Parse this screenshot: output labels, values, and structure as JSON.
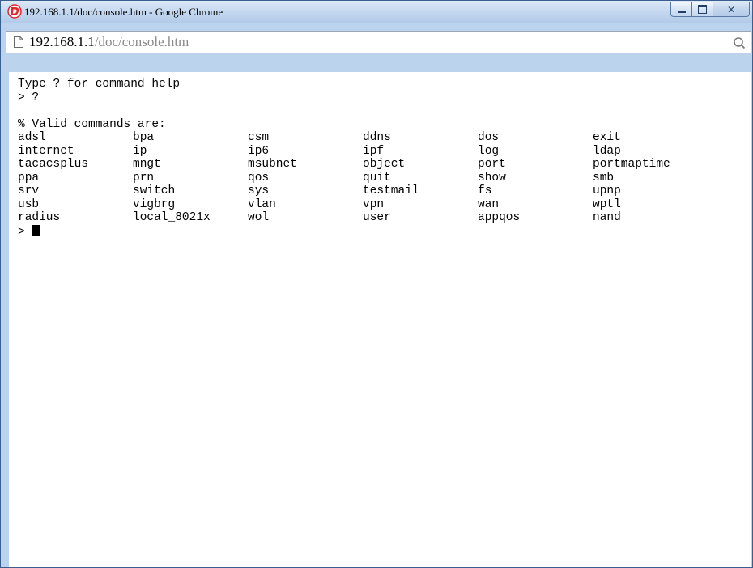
{
  "window": {
    "title": "192.168.1.1/doc/console.htm - Google Chrome",
    "controls": {
      "minimize": "minimize",
      "maximize": "maximize",
      "close": "close"
    }
  },
  "address_bar": {
    "host": "192.168.1.1",
    "path": "/doc/console.htm"
  },
  "console": {
    "help_hint": "Type ? for command help",
    "prompt_line": "> ?",
    "blank": "",
    "commands_header": "% Valid commands are:",
    "commands": [
      [
        "adsl",
        "bpa",
        "csm",
        "ddns",
        "dos",
        "exit"
      ],
      [
        "internet",
        "ip",
        "ip6",
        "ipf",
        "log",
        "ldap"
      ],
      [
        "tacacsplus",
        "mngt",
        "msubnet",
        "object",
        "port",
        "portmaptime"
      ],
      [
        "ppa",
        "prn",
        "qos",
        "quit",
        "show",
        "smb"
      ],
      [
        "srv",
        "switch",
        "sys",
        "testmail",
        "fs",
        "upnp"
      ],
      [
        "usb",
        "vigbrg",
        "vlan",
        "vpn",
        "wan",
        "wptl"
      ],
      [
        "radius",
        "local_8021x",
        "wol",
        "user",
        "appqos",
        "nand"
      ]
    ],
    "current_prompt": ">"
  },
  "icons": {
    "app": "draytek-app-icon",
    "page": "page-icon",
    "search": "search-icon"
  },
  "colors": {
    "titlebar": "#c4d8ef",
    "window_frame": "#bcd3ee",
    "url_path": "#8a8a8a",
    "app_icon": "#e3262d"
  }
}
